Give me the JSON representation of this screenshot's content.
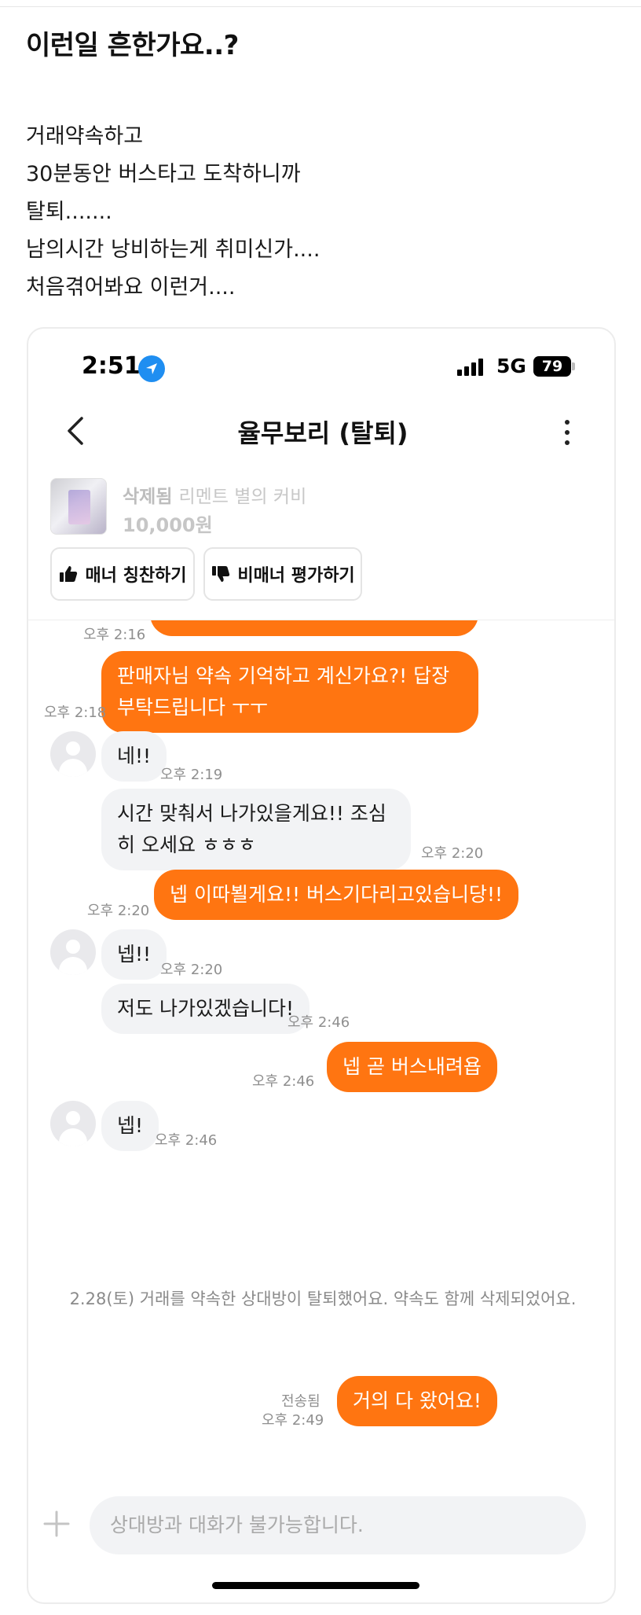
{
  "post": {
    "title": "이런일 흔한가요..?",
    "body": [
      "거래약속하고",
      "30분동안 버스타고 도착하니까",
      "탈퇴.......",
      "남의시간 낭비하는게 취미신가....",
      "처음겪어봐요 이런거...."
    ]
  },
  "status_bar": {
    "time": "2:51",
    "network": "5G",
    "battery": "79"
  },
  "header": {
    "title": "율무보리 (탈퇴)",
    "back_icon": "chevron-left-icon",
    "more_icon": "more-vertical-icon"
  },
  "product": {
    "status": "삭제됨",
    "name": "리멘트 별의 커비",
    "price": "10,000원"
  },
  "actions": {
    "praise_label": "매너 칭찬하기",
    "report_label": "비매너 평가하기"
  },
  "colors": {
    "accent": "#ff7511",
    "bubble_in": "#f2f3f5"
  },
  "messages": [
    {
      "side": "out",
      "text": "",
      "time": "오후 2:16"
    },
    {
      "side": "out",
      "text": "판매자님 약속 기억하고 계신가요?! 답장 부탁드립니다 ㅜㅜ",
      "time": "오후 2:18"
    },
    {
      "side": "in",
      "text": "네!!",
      "time": "오후 2:19"
    },
    {
      "side": "in",
      "text": "시간 맞춰서 나가있을게요!! 조심히 오세요 ㅎㅎㅎ",
      "time": "오후 2:20"
    },
    {
      "side": "out",
      "text": "넵 이따뵐게요!! 버스기다리고있습니당!!",
      "time": "오후 2:20"
    },
    {
      "side": "in",
      "text": "넵!!",
      "time": "오후 2:20"
    },
    {
      "side": "in",
      "text": "저도 나가있겠습니다!",
      "time": "오후 2:46"
    },
    {
      "side": "out",
      "text": "넵 곧 버스내려욥",
      "time": "오후 2:46"
    },
    {
      "side": "in",
      "text": "넵!",
      "time": "오후 2:46"
    },
    {
      "side": "out",
      "text": "거의 다 왔어요!",
      "time": "오후 2:49",
      "status": "전송됨"
    }
  ],
  "system_message": "2.28(토) 거래를 약속한 상대방이 탈퇴했어요. 약속도 함께 삭제되었어요.",
  "input": {
    "placeholder": "상대방과 대화가 불가능합니다."
  }
}
